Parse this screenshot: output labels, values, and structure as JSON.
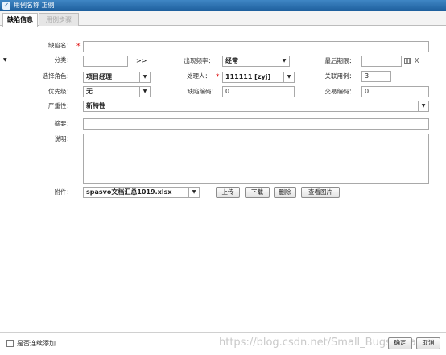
{
  "window": {
    "title": "用例名称 正例"
  },
  "tabs": [
    {
      "label": "缺陷信息",
      "active": true
    },
    {
      "label": "用例步骤",
      "active": false
    }
  ],
  "form": {
    "defect_name": {
      "label": "缺陷名：",
      "value": ""
    },
    "category": {
      "label": "分类：",
      "value": "",
      "more": ">>"
    },
    "frequency": {
      "label": "出现频率：",
      "value": "经常"
    },
    "deadline": {
      "label": "最后期限：",
      "value": "",
      "clear": "X"
    },
    "role": {
      "label": "选择角色：",
      "value": "项目经理"
    },
    "handler": {
      "label": "处理人：",
      "value": "111111 [zyj]"
    },
    "related_case": {
      "label": "关联用例：",
      "value": "3"
    },
    "priority": {
      "label": "优先级：",
      "value": "无"
    },
    "defect_code": {
      "label": "缺陷编码：",
      "value": "0"
    },
    "trade_code": {
      "label": "交易编码：",
      "value": "0"
    },
    "severity": {
      "label": "严重性：",
      "value": "新特性"
    },
    "summary": {
      "label": "摘要：",
      "value": ""
    },
    "description": {
      "label": "说明：",
      "value": ""
    },
    "attachment": {
      "label": "附件：",
      "value": "spasvo文档汇总1019.xlsx"
    }
  },
  "attachment_buttons": {
    "upload": "上传",
    "download": "下载",
    "delete": "删除",
    "view_image": "查看图片"
  },
  "footer": {
    "continuous_add": "是否连续添加",
    "confirm": "确定",
    "cancel": "取消",
    "watermark": "https://blog.csdn.net/Small_Bugs_Spasvo"
  }
}
